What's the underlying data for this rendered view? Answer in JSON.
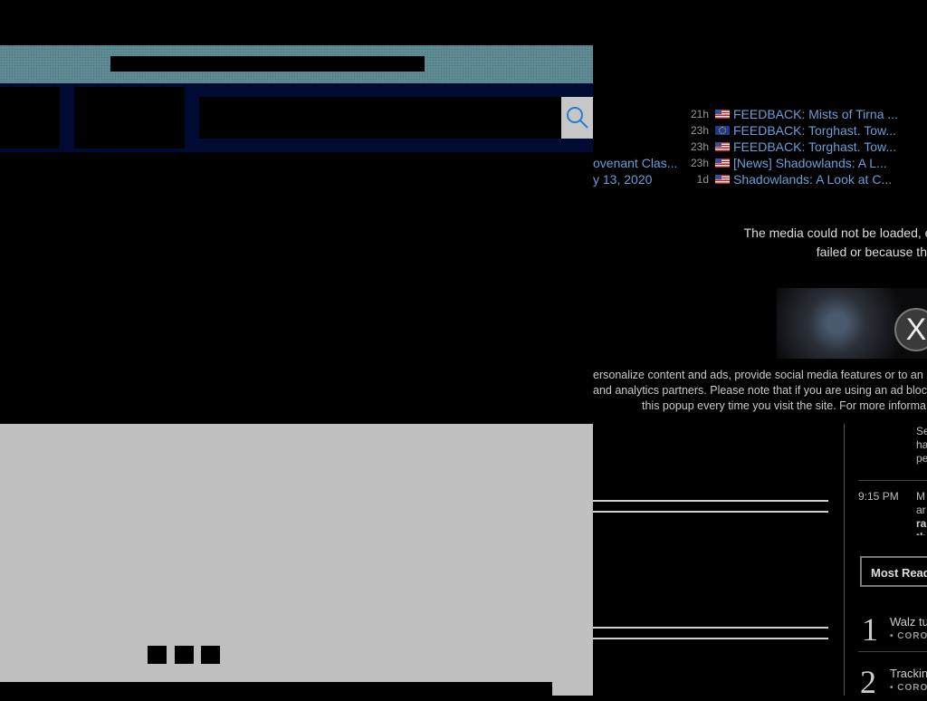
{
  "feed": {
    "items": [
      {
        "time": "21h",
        "flag": "us",
        "title": "FEEDBACK: Mists of Tirna ..."
      },
      {
        "time": "23h",
        "flag": "eu",
        "title": "FEEDBACK: Torghast. Tow..."
      },
      {
        "time": "23h",
        "flag": "us",
        "title": "FEEDBACK: Torghast. Tow..."
      },
      {
        "time": "23h",
        "flag": "us",
        "title": "[News] Shadowlands: A L...",
        "left_text": "ovenant Clas..."
      },
      {
        "time": "1d",
        "flag": "us",
        "title": "Shadowlands: A Look at C...",
        "left_text": "y 13, 2020"
      }
    ]
  },
  "media_error": {
    "line1": "The media could not be loaded, eithe",
    "line2": "failed or because the for"
  },
  "close_button": {
    "label": "X"
  },
  "cookie_notice": {
    "line1": "ersonalize content and ads, provide social media features or to an",
    "line2": "and analytics partners. Please note that if you are using an ad bloc",
    "line3": "this popup every time you visit the site. For more informa"
  },
  "right_panel": {
    "snippet1": [
      "Se",
      "ha",
      "pe"
    ],
    "time2": "9:15 PM",
    "snippet2": [
      "M",
      "ar",
      "ra",
      "th"
    ],
    "most_read_label": "Most Read",
    "ranked": [
      {
        "rank": "1",
        "title": "Walz tu",
        "tag": "• CORO"
      },
      {
        "rank": "2",
        "title": "Trackin",
        "tag": "• CORO"
      }
    ]
  },
  "icons": {
    "search": "search-icon",
    "close": "close-icon"
  }
}
